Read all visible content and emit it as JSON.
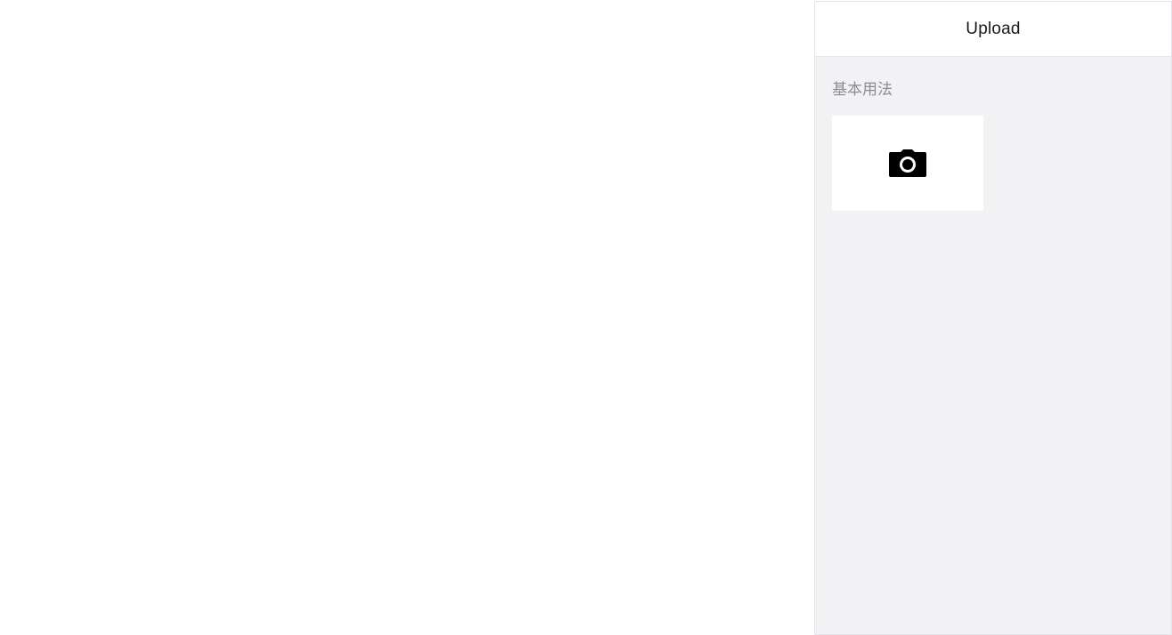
{
  "navbar": {
    "title": "Upload"
  },
  "section": {
    "title": "基本用法"
  },
  "uploader": {
    "icon": "camera-icon"
  },
  "colors": {
    "page_bg": "#ffffff",
    "panel_bg": "#f2f2f4",
    "navbar_bg": "#ffffff",
    "section_title": "#8a8b96",
    "icon": "#000000"
  }
}
